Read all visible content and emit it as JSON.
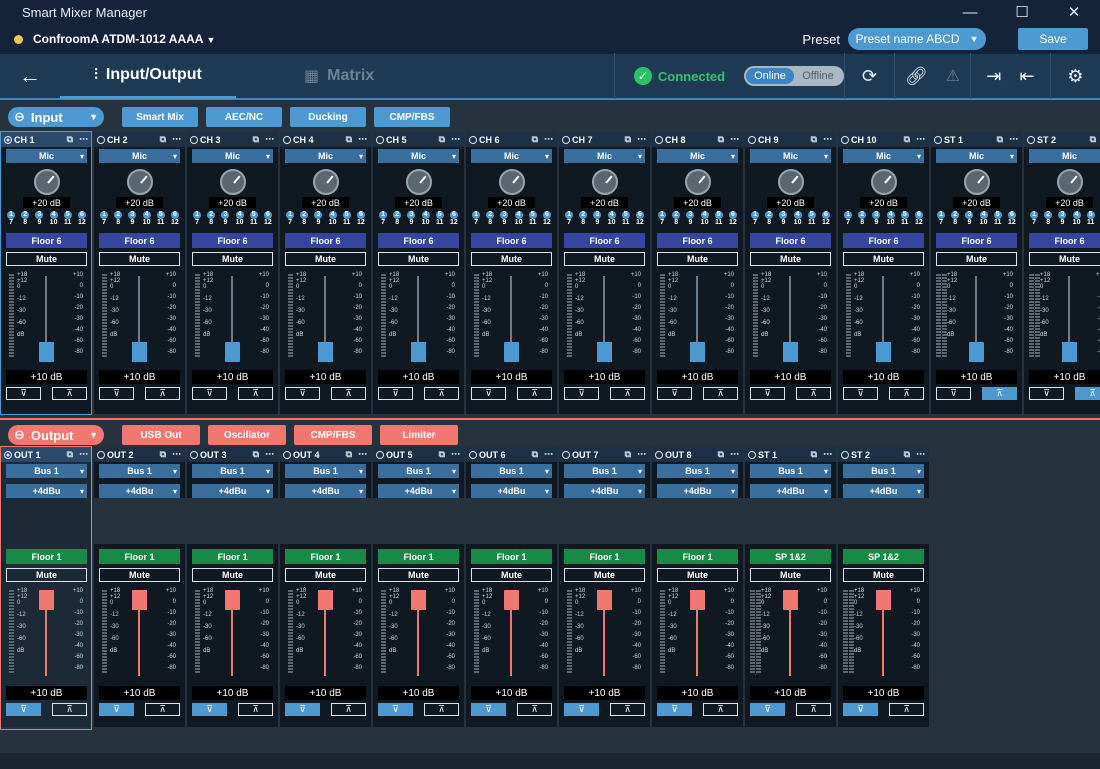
{
  "app": {
    "title": "Smart Mixer Manager",
    "device": "ConfroomA ATDM-1012 AAAA"
  },
  "preset": {
    "label": "Preset",
    "value": "Preset name ABCD",
    "save": "Save"
  },
  "tabs": [
    {
      "label": "Input/Output"
    },
    {
      "label": "Matrix"
    }
  ],
  "status": {
    "connected": "Connected",
    "online": "Online",
    "offline": "Offline"
  },
  "input_section": {
    "label": "Input",
    "buttons": [
      "Smart Mix",
      "AEC/NC",
      "Ducking",
      "CMP/FBS"
    ]
  },
  "output_section": {
    "label": "Output",
    "buttons": [
      "USB Out",
      "Oscillator",
      "CMP/FBS",
      "Limiter"
    ]
  },
  "input_channels": [
    {
      "name": "CH 1",
      "type": "Mic",
      "gain": "+20 dB",
      "route": "Floor 6",
      "mute": "Mute",
      "level": "+10 dB"
    },
    {
      "name": "CH 2",
      "type": "Mic",
      "gain": "+20 dB",
      "route": "Floor 6",
      "mute": "Mute",
      "level": "+10 dB"
    },
    {
      "name": "CH 3",
      "type": "Mic",
      "gain": "+20 dB",
      "route": "Floor 6",
      "mute": "Mute",
      "level": "+10 dB"
    },
    {
      "name": "CH 4",
      "type": "Mic",
      "gain": "+20 dB",
      "route": "Floor 6",
      "mute": "Mute",
      "level": "+10 dB"
    },
    {
      "name": "CH 5",
      "type": "Mic",
      "gain": "+20 dB",
      "route": "Floor 6",
      "mute": "Mute",
      "level": "+10 dB"
    },
    {
      "name": "CH 6",
      "type": "Mic",
      "gain": "+20 dB",
      "route": "Floor 6",
      "mute": "Mute",
      "level": "+10 dB"
    },
    {
      "name": "CH 7",
      "type": "Mic",
      "gain": "+20 dB",
      "route": "Floor 6",
      "mute": "Mute",
      "level": "+10 dB"
    },
    {
      "name": "CH 8",
      "type": "Mic",
      "gain": "+20 dB",
      "route": "Floor 6",
      "mute": "Mute",
      "level": "+10 dB"
    },
    {
      "name": "CH 9",
      "type": "Mic",
      "gain": "+20 dB",
      "route": "Floor 6",
      "mute": "Mute",
      "level": "+10 dB"
    },
    {
      "name": "CH 10",
      "type": "Mic",
      "gain": "+20 dB",
      "route": "Floor 6",
      "mute": "Mute",
      "level": "+10 dB"
    },
    {
      "name": "ST 1",
      "type": "Mic",
      "gain": "+20 dB",
      "route": "Floor 6",
      "mute": "Mute",
      "level": "+10 dB"
    },
    {
      "name": "ST 2",
      "type": "Mic",
      "gain": "+20 dB",
      "route": "Floor 6",
      "mute": "Mute",
      "level": "+10 dB"
    }
  ],
  "output_channels": [
    {
      "name": "OUT 1",
      "bus": "Bus 1",
      "level_sel": "+4dBu",
      "route": "Floor 1",
      "mute": "Mute",
      "level": "+10 dB"
    },
    {
      "name": "OUT 2",
      "bus": "Bus 1",
      "level_sel": "+4dBu",
      "route": "Floor 1",
      "mute": "Mute",
      "level": "+10 dB"
    },
    {
      "name": "OUT 3",
      "bus": "Bus 1",
      "level_sel": "+4dBu",
      "route": "Floor 1",
      "mute": "Mute",
      "level": "+10 dB"
    },
    {
      "name": "OUT 4",
      "bus": "Bus 1",
      "level_sel": "+4dBu",
      "route": "Floor 1",
      "mute": "Mute",
      "level": "+10 dB"
    },
    {
      "name": "OUT 5",
      "bus": "Bus 1",
      "level_sel": "+4dBu",
      "route": "Floor 1",
      "mute": "Mute",
      "level": "+10 dB"
    },
    {
      "name": "OUT 6",
      "bus": "Bus 1",
      "level_sel": "+4dBu",
      "route": "Floor 1",
      "mute": "Mute",
      "level": "+10 dB"
    },
    {
      "name": "OUT 7",
      "bus": "Bus 1",
      "level_sel": "+4dBu",
      "route": "Floor 1",
      "mute": "Mute",
      "level": "+10 dB"
    },
    {
      "name": "OUT 8",
      "bus": "Bus 1",
      "level_sel": "+4dBu",
      "route": "Floor 1",
      "mute": "Mute",
      "level": "+10 dB"
    },
    {
      "name": "ST 1",
      "bus": "Bus 1",
      "level_sel": "+4dBu",
      "route": "SP 1&2",
      "mute": "Mute",
      "level": "+10 dB"
    },
    {
      "name": "ST 2",
      "bus": "Bus 1",
      "level_sel": "+4dBu",
      "route": "SP 1&2",
      "mute": "Mute",
      "level": "+10 dB"
    }
  ],
  "matrix_numbers": [
    "1",
    "2",
    "3",
    "4",
    "5",
    "6",
    "7",
    "8",
    "9",
    "10",
    "11",
    "12"
  ],
  "scale_left": [
    "+18",
    "+12",
    "0",
    "-12",
    "-30",
    "-60",
    "dB"
  ],
  "scale_right": [
    "+10",
    "0",
    "-10",
    "-20",
    "-30",
    "-40",
    "-60",
    "-80"
  ],
  "colors": {
    "accent": "#4d9ad3",
    "output": "#f07870",
    "connected": "#2ec163",
    "input_route": "#3646a0",
    "output_route": "#188a48"
  }
}
